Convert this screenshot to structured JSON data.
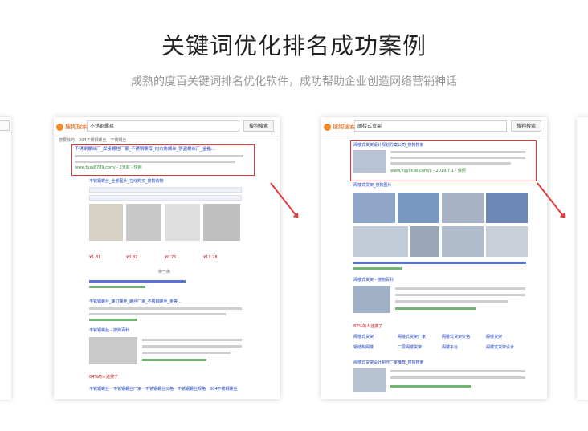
{
  "header": {
    "title": "关键词优化排名成功案例",
    "subtitle": "成熟的度百关键词排名优化软件，成功帮助企业创造网络营销神话"
  },
  "search_engine": {
    "logo": "搜狗搜索",
    "button": "搜狗搜索"
  },
  "case1": {
    "query": "不锈钢螺丝",
    "hint": "您要找的：304不锈钢螺丝 · 不锈钢丝",
    "top_result_title": "不锈钢螺丝厂_焊接螺柱厂家_不锈钢螺母_内六角螺丝_防盗螺丝厂_金福…",
    "top_result_url": "www.fuxs8789.com/ - 2天前 - 快照",
    "section_title": "不锈钢螺丝_全部图片_在线购买_搜狗购物",
    "product_prices": [
      "¥1.81",
      "¥0.82",
      "¥0.75",
      "¥11.28"
    ],
    "pagination": "换一换",
    "result2_title": "不锈钢螺丝_螺钉螺栓_螺丝厂家_不锈钢螺丝_金荟…",
    "result3_title": "不锈钢螺丝 - 搜狗百科",
    "related_label": "84%的人还搜了",
    "related": [
      "不锈钢螺丝",
      "不锈钢螺丝厂家",
      "不锈钢螺丝价格",
      "不锈钢螺丝规格",
      "304不锈钢螺丝"
    ]
  },
  "case2": {
    "query": "阁楼式货架",
    "top_result_title": "阁楼式货架设计规划方案公司_搜狗搜索",
    "top_result_url": "www.yuyanlei.com/a - 2019.7.1 - 快照",
    "section_title": "阁楼式货架_搜狗图片",
    "result2_title": "阁楼式货架 - 搜狗百科",
    "related_label": "87%的人还搜了",
    "related": [
      "阁楼式货架",
      "阁楼式货架厂家",
      "阁楼式货架价格",
      "阁楼货架",
      "钢结构阁楼",
      "二层阁楼货架",
      "阁楼平台",
      "阁楼式货架设计"
    ],
    "result3_title": "阁楼式货架设计制作厂家推荐_搜狗搜索"
  }
}
